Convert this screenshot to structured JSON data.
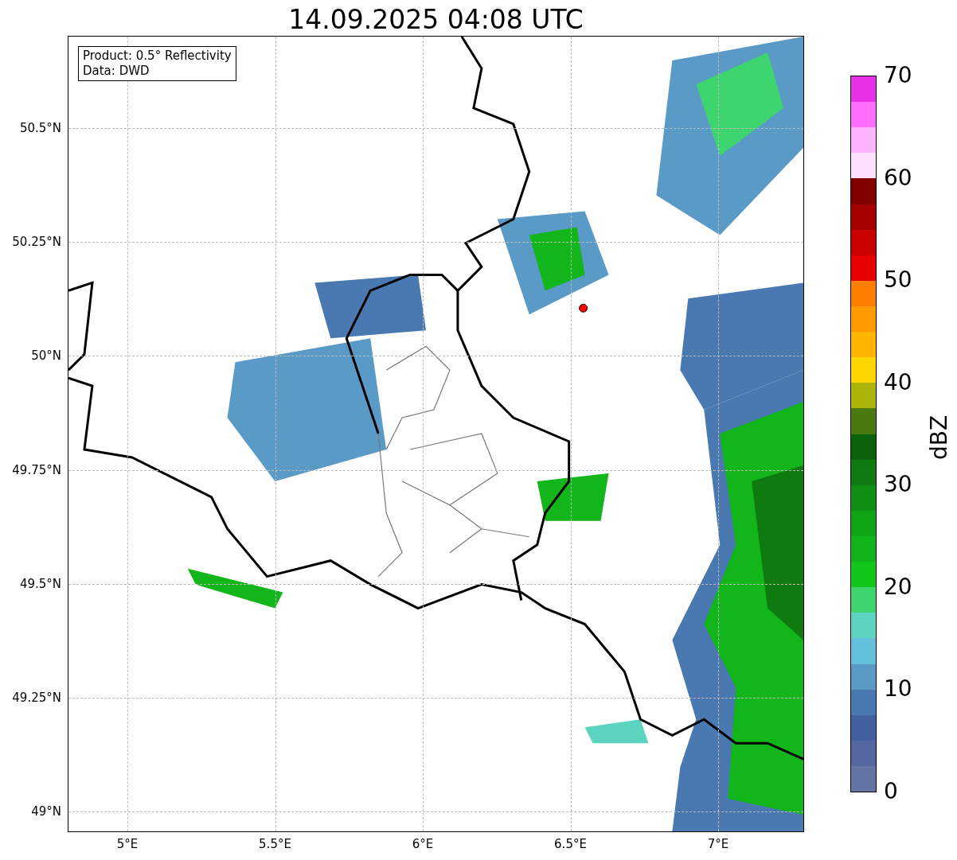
{
  "title": "14.09.2025 04:08 UTC",
  "legend": [
    "Product: 0.5° Reflectivity",
    "Data: DWD"
  ],
  "map": {
    "lat_ticks": [
      "50.5°N",
      "50.25°N",
      "50°N",
      "49.75°N",
      "49.5°N",
      "49.25°N",
      "49°N"
    ],
    "lon_ticks": [
      "5°E",
      "5.5°E",
      "6°E",
      "6.5°E",
      "7°E"
    ]
  },
  "colorbar": {
    "label": "dBZ",
    "ticks": [
      "70",
      "60",
      "50",
      "40",
      "30",
      "20",
      "10",
      "0"
    ],
    "segments": [
      {
        "color": "#e832e8"
      },
      {
        "color": "#ff6eff"
      },
      {
        "color": "#ffb4ff"
      },
      {
        "color": "#ffe0ff"
      },
      {
        "color": "#800000"
      },
      {
        "color": "#a40000"
      },
      {
        "color": "#c80000"
      },
      {
        "color": "#e60000"
      },
      {
        "color": "#ff7d00"
      },
      {
        "color": "#ff9a00"
      },
      {
        "color": "#ffb400"
      },
      {
        "color": "#ffd700"
      },
      {
        "color": "#acb40a"
      },
      {
        "color": "#487a10"
      },
      {
        "color": "#0b620d"
      },
      {
        "color": "#0e7a10"
      },
      {
        "color": "#0f8f14"
      },
      {
        "color": "#10a417"
      },
      {
        "color": "#11b51a"
      },
      {
        "color": "#12c61a"
      },
      {
        "color": "#3fd56e"
      },
      {
        "color": "#5dd4c0"
      },
      {
        "color": "#64c0dc"
      },
      {
        "color": "#5a9ac6"
      },
      {
        "color": "#4a78b0"
      },
      {
        "color": "#4361a0"
      },
      {
        "color": "#5567a0"
      },
      {
        "color": "#6475a5"
      }
    ]
  }
}
